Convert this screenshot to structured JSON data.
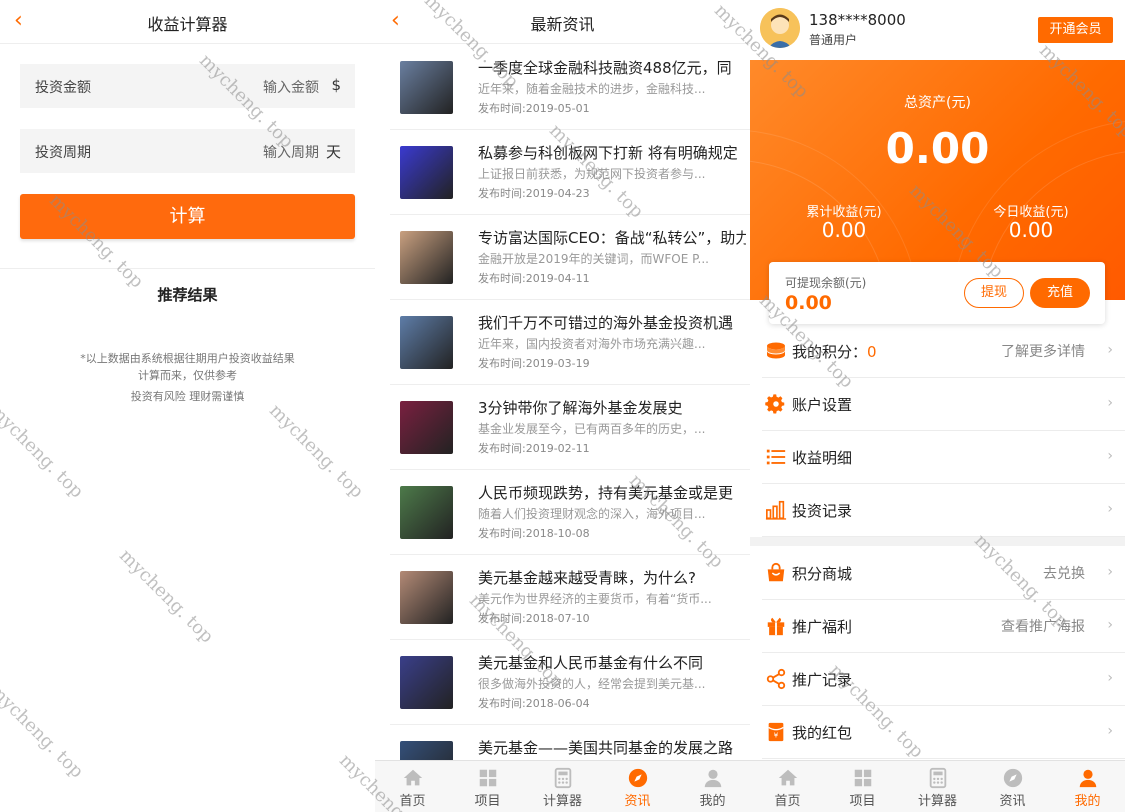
{
  "calculator": {
    "back_icon": "chevron-left-icon",
    "title": "收益计算器",
    "amount_label": "投资金额",
    "amount_placeholder": "输入金额",
    "amount_unit": "$",
    "period_label": "投资周期",
    "period_placeholder": "输入周期",
    "period_unit": "天",
    "calc_button": "计算",
    "result_title": "推荐结果",
    "note_line1": "*以上数据由系统根据往期用户投资收益结果",
    "note_line2": "计算而来，仅供参考",
    "note_line3": "投资有风险 理财需谨慎"
  },
  "news": {
    "back_icon": "chevron-left-icon",
    "title": "最新资讯",
    "items": [
      {
        "title": "一季度全球金融科技融资488亿元，同",
        "desc": "近年来，随着金融技术的进步，金融科技...",
        "date": "发布时间:2019-05-01",
        "thumb_color": "#6a7fa0"
      },
      {
        "title": "私募参与科创板网下打新 将有明确规定",
        "desc": "上证报日前获悉，为规范网下投资者参与...",
        "date": "发布时间:2019-04-23",
        "thumb_color": "#3a3ad0"
      },
      {
        "title": "专访富达国际CEO：备战“私转公”，助力",
        "desc": "金融开放是2019年的关键词，而WFOE P...",
        "date": "发布时间:2019-04-11",
        "thumb_color": "#c9a080"
      },
      {
        "title": "我们千万不可错过的海外基金投资机遇",
        "desc": "近年来，国内投资者对海外市场充满兴趣...",
        "date": "发布时间:2019-03-19",
        "thumb_color": "#5e7da8"
      },
      {
        "title": "3分钟带你了解海外基金发展史",
        "desc": "基金业发展至今，已有两百多年的历史，...",
        "date": "发布时间:2019-02-11",
        "thumb_color": "#7a2040"
      },
      {
        "title": "人民币频现跌势，持有美元基金或是更",
        "desc": "随着人们投资理财观念的深入，海外项目...",
        "date": "发布时间:2018-10-08",
        "thumb_color": "#4d7a4a"
      },
      {
        "title": "美元基金越来越受青睐，为什么?",
        "desc": "美元作为世界经济的主要货币，有着“货币...",
        "date": "发布时间:2018-07-10",
        "thumb_color": "#b38a76"
      },
      {
        "title": "美元基金和人民币基金有什么不同",
        "desc": "很多做海外投资的人，经常会提到美元基...",
        "date": "发布时间:2018-06-04",
        "thumb_color": "#3a3f8a"
      },
      {
        "title": "美元基金——美国共同基金的发展之路",
        "desc": "",
        "date": "",
        "thumb_color": "#34507a"
      }
    ]
  },
  "profile": {
    "avatar_icon": "user-avatar-icon",
    "phone": "138****8000",
    "level": "普通用户",
    "vip_button": "开通会员",
    "total_label": "总资产(元)",
    "total_value": "0.00",
    "cum_label": "累计收益(元)",
    "cum_value": "0.00",
    "today_label": "今日收益(元)",
    "today_value": "0.00",
    "withdrawable_label": "可提现余额(元)",
    "withdrawable_value": "0.00",
    "withdraw_button": "提现",
    "recharge_button": "充值",
    "points_label": "我的积分：",
    "points_value": "0",
    "points_more": "了解更多详情",
    "menu1": [
      {
        "label": "账户设置",
        "icon": "gear-icon"
      },
      {
        "label": "收益明细",
        "icon": "list-icon"
      },
      {
        "label": "投资记录",
        "icon": "bar-chart-icon"
      }
    ],
    "menu2": [
      {
        "label": "积分商城",
        "right": "去兑换",
        "icon": "shop-bag-icon"
      },
      {
        "label": "推广福利",
        "right": "查看推广海报",
        "icon": "gift-icon"
      },
      {
        "label": "推广记录",
        "right": "",
        "icon": "share-icon"
      },
      {
        "label": "我的红包",
        "right": "",
        "icon": "red-envelope-icon"
      }
    ],
    "accent": "#ff6a00"
  },
  "tabbar_news": [
    {
      "label": "首页",
      "icon": "home-icon",
      "active": false
    },
    {
      "label": "项目",
      "icon": "grid-icon",
      "active": false
    },
    {
      "label": "计算器",
      "icon": "calculator-icon",
      "active": false
    },
    {
      "label": "资讯",
      "icon": "compass-icon",
      "active": true
    },
    {
      "label": "我的",
      "icon": "user-icon",
      "active": false
    }
  ],
  "tabbar_profile": [
    {
      "label": "首页",
      "icon": "home-icon",
      "active": false
    },
    {
      "label": "项目",
      "icon": "grid-icon",
      "active": false
    },
    {
      "label": "计算器",
      "icon": "calculator-icon",
      "active": false
    },
    {
      "label": "资讯",
      "icon": "compass-icon",
      "active": false
    },
    {
      "label": "我的",
      "icon": "user-icon",
      "active": true
    }
  ],
  "watermark": "mycheng. top"
}
